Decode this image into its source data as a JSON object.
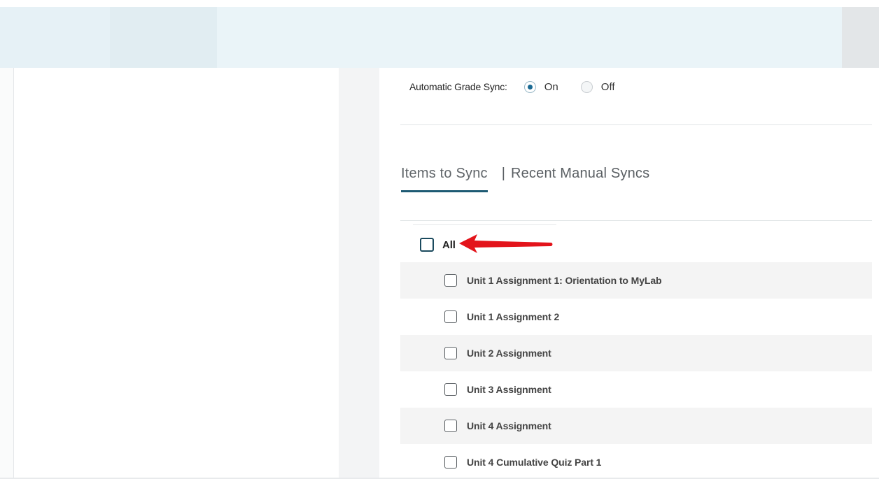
{
  "grade_sync": {
    "label": "Automatic Grade Sync:",
    "options": [
      {
        "label": "On",
        "selected": true
      },
      {
        "label": "Off",
        "selected": false
      }
    ]
  },
  "tabs": [
    {
      "label": "Items to Sync",
      "active": true
    },
    {
      "label": "Recent Manual Syncs",
      "active": false
    }
  ],
  "tab_separator": "|",
  "items": {
    "all_label": "All",
    "list": [
      {
        "label": "Unit 1 Assignment 1: Orientation to MyLab"
      },
      {
        "label": "Unit 1 Assignment 2"
      },
      {
        "label": "Unit 2 Assignment"
      },
      {
        "label": "Unit 3 Assignment"
      },
      {
        "label": "Unit 4 Assignment"
      },
      {
        "label": "Unit 4 Cumulative Quiz Part 1"
      }
    ]
  },
  "colors": {
    "accent": "#1d5a73",
    "radio_dot": "#1a6a93",
    "annotation_arrow": "#e3141b"
  },
  "annotation": {
    "icon": "red-arrow-icon"
  }
}
